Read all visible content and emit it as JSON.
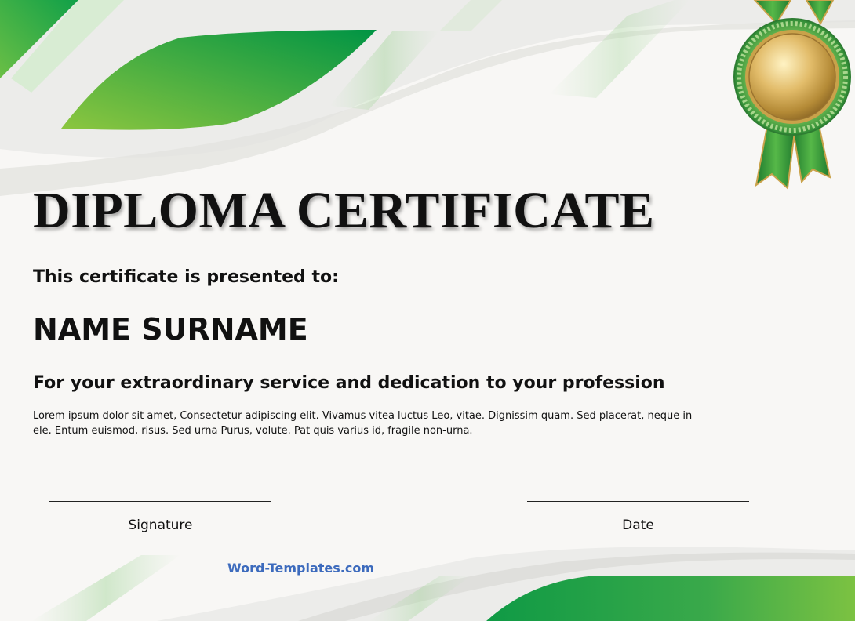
{
  "certificate": {
    "title": "DIPLOMA CERTIFICATE",
    "presented_to": "This certificate is presented to:",
    "recipient_name": "NAME SURNAME",
    "dedication": "For your extraordinary service and dedication to your profession",
    "body": "Lorem ipsum dolor sit amet, Consectetur adipiscing elit. Vivamus vitea luctus Leo, vitae.  Dignissim quam. Sed placerat, neque in ele. Entum euismod, risus. Sed urna Purus, volute. Pat quis varius id, fragile non-urna.",
    "signature_label": "Signature",
    "date_label": "Date",
    "brand": "Word-Templates.com"
  },
  "colors": {
    "green_dark": "#0a9a46",
    "green_light": "#7cc242",
    "gold": "#c9a24a",
    "brand_blue": "#3d6bbd"
  },
  "icons": {
    "medal": "gold-rosette-medal-icon"
  }
}
